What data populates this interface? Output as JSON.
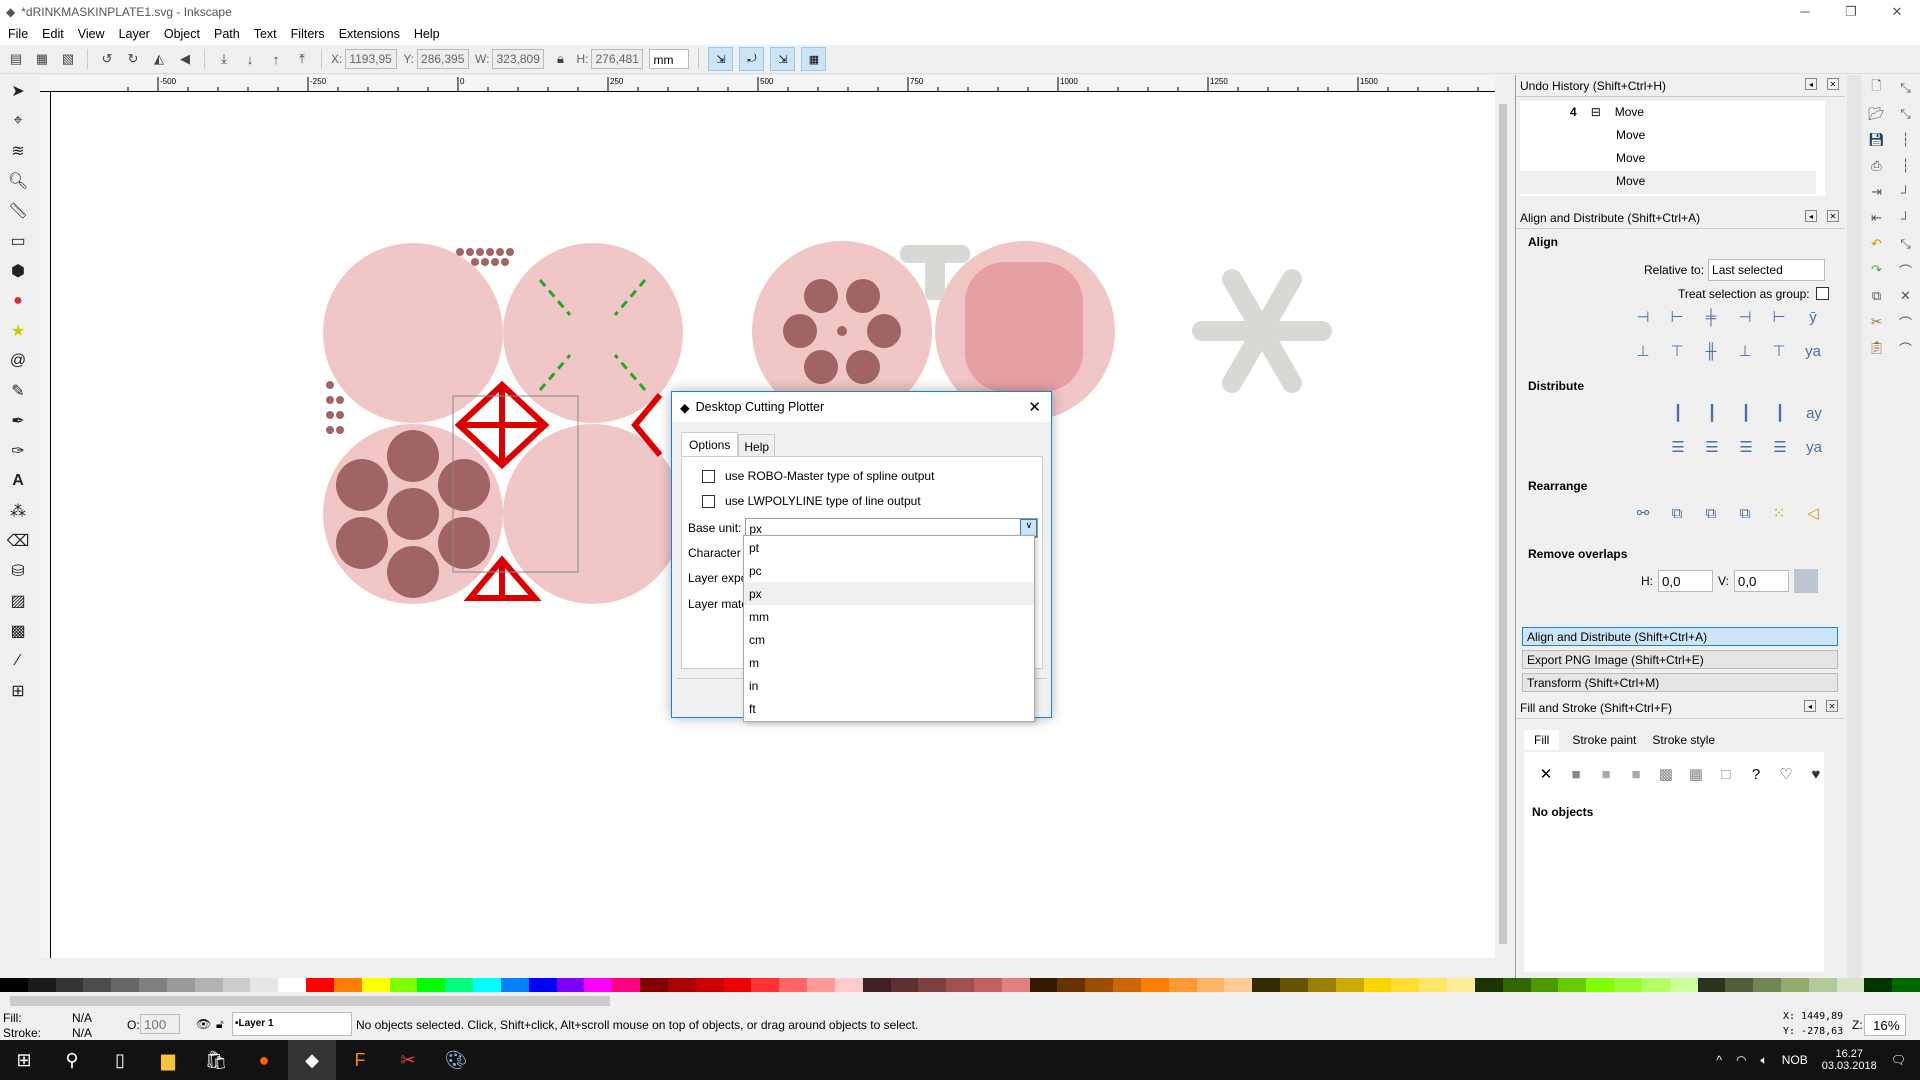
{
  "window": {
    "title": "*dRINKMASKINPLATE1.svg - Inkscape",
    "controls": [
      "─",
      "❐",
      "✕"
    ]
  },
  "menu": [
    "File",
    "Edit",
    "View",
    "Layer",
    "Object",
    "Path",
    "Text",
    "Filters",
    "Extensions",
    "Help"
  ],
  "toolbar": {
    "x_label": "X:",
    "x": "1193,95",
    "y_label": "Y:",
    "y": "286,395",
    "w_label": "W:",
    "w": "323,809",
    "h_label": "H:",
    "h": "276,481",
    "unit": "mm"
  },
  "ruler": {
    "ticks": [
      "-500",
      "-250",
      "0",
      "250",
      "500",
      "750",
      "1000",
      "1250",
      "1500"
    ]
  },
  "undo_history": {
    "title": "Undo History (Shift+Ctrl+H)",
    "items": [
      {
        "num": "4",
        "label": "Move"
      },
      {
        "num": "",
        "label": "Move"
      },
      {
        "num": "",
        "label": "Move"
      },
      {
        "num": "",
        "label": "Move"
      }
    ]
  },
  "align": {
    "title": "Align and Distribute (Shift+Ctrl+A)",
    "align_heading": "Align",
    "relative_label": "Relative to:",
    "relative_value": "Last selected",
    "treat_group_label": "Treat selection as group:",
    "distribute_heading": "Distribute",
    "rearrange_heading": "Rearrange",
    "remove_overlaps_heading": "Remove overlaps",
    "h_label": "H:",
    "h_value": "0,0",
    "v_label": "V:",
    "v_value": "0,0"
  },
  "collapsed_panels": [
    "Align and Distribute (Shift+Ctrl+A)",
    "Export PNG Image (Shift+Ctrl+E)",
    "Transform (Shift+Ctrl+M)"
  ],
  "fill_stroke": {
    "title": "Fill and Stroke (Shift+Ctrl+F)",
    "tabs": [
      "Fill",
      "Stroke paint",
      "Stroke style"
    ],
    "status": "No objects"
  },
  "dialog": {
    "title": "Desktop Cutting Plotter",
    "tabs": [
      "Options",
      "Help"
    ],
    "opt1": "use ROBO-Master type of spline output",
    "opt2": "use LWPOLYLINE type of line output",
    "base_unit_label": "Base unit:",
    "base_unit_value": "px",
    "row_labels": [
      "Character",
      "Layer expo",
      "Layer matc"
    ],
    "units": [
      "pt",
      "pc",
      "px",
      "mm",
      "cm",
      "m",
      "in",
      "ft"
    ],
    "highlighted": "px"
  },
  "status": {
    "fill_label": "Fill:",
    "fill_value": "N/A",
    "stroke_label": "Stroke:",
    "stroke_value": "N/A",
    "opacity_label": "O:",
    "opacity": "100",
    "layer": "•Layer 1",
    "message": "No objects selected. Click, Shift+click, Alt+scroll mouse on top of objects, or drag around objects to select.",
    "cursor_x": "X: 1449,89",
    "cursor_y": "Y: -278,63",
    "zoom_label": "Z:",
    "zoom": "16%"
  },
  "taskbar": {
    "lang": "NOB",
    "time": "16.27",
    "date": "03.03.2018"
  },
  "colors": {
    "accent": "#1883d7",
    "plate": "#f0c6c6",
    "hole": "#a06464",
    "red": "#dd0000",
    "green": "#22aa22"
  }
}
